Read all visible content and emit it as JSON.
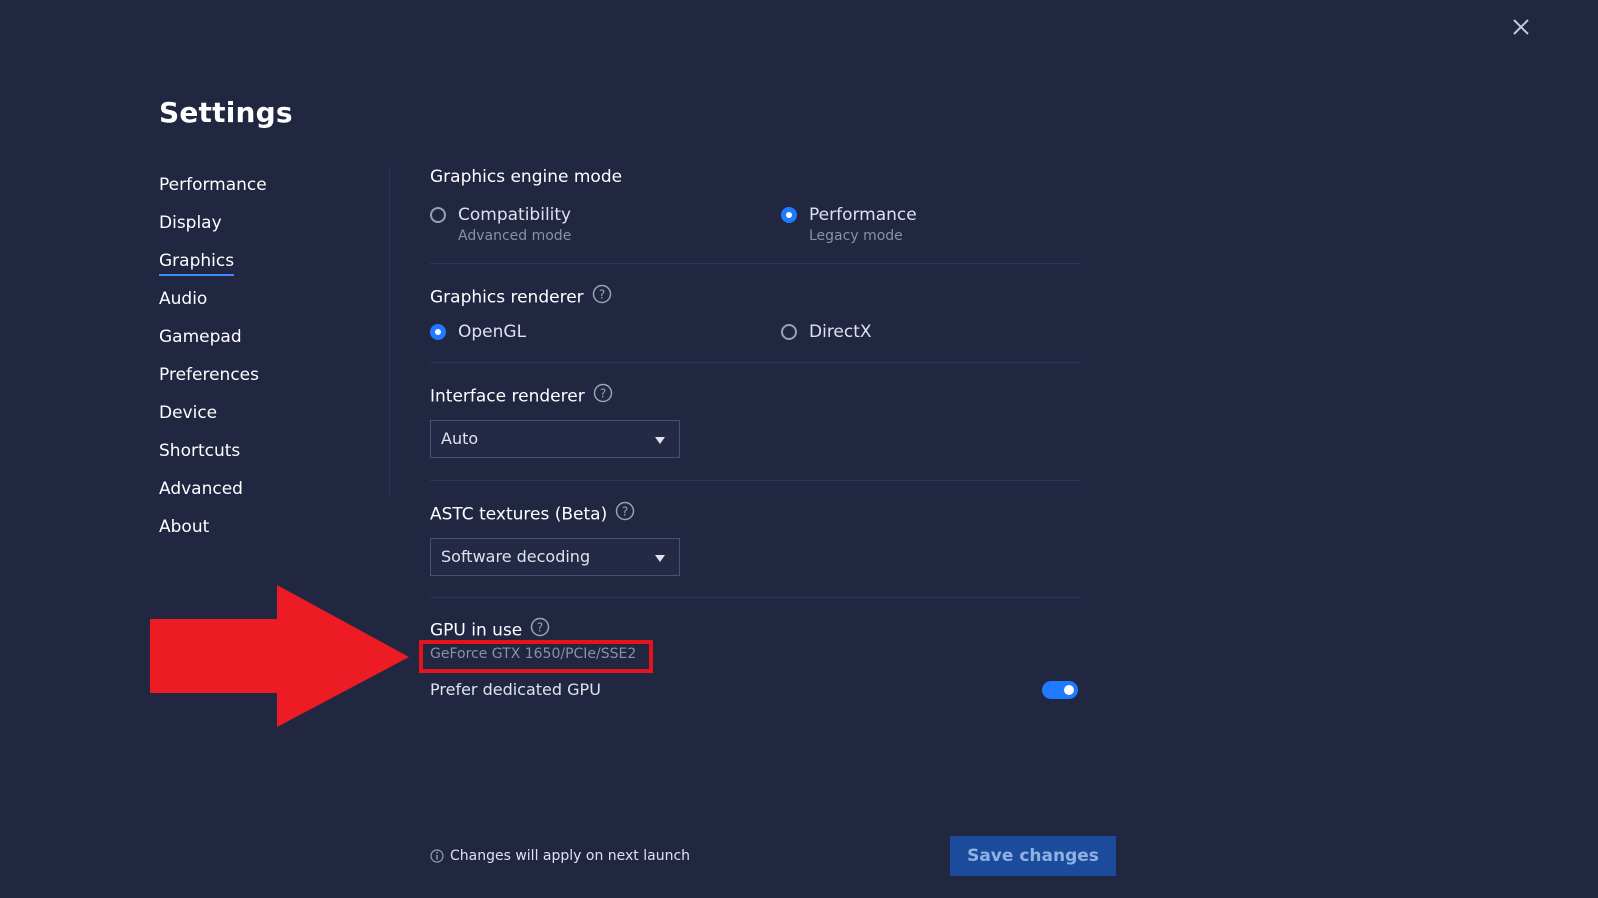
{
  "title": "Settings",
  "nav": {
    "items": [
      "Performance",
      "Display",
      "Graphics",
      "Audio",
      "Gamepad",
      "Preferences",
      "Device",
      "Shortcuts",
      "Advanced",
      "About"
    ],
    "active": "Graphics"
  },
  "engine": {
    "title": "Graphics engine mode",
    "options": [
      {
        "label": "Compatibility",
        "sub": "Advanced mode",
        "selected": false
      },
      {
        "label": "Performance",
        "sub": "Legacy mode",
        "selected": true
      }
    ]
  },
  "renderer": {
    "title": "Graphics renderer",
    "options": [
      {
        "label": "OpenGL",
        "selected": true
      },
      {
        "label": "DirectX",
        "selected": false
      }
    ]
  },
  "interface_renderer": {
    "title": "Interface renderer",
    "value": "Auto"
  },
  "astc": {
    "title": "ASTC textures (Beta)",
    "value": "Software decoding"
  },
  "gpu": {
    "title": "GPU in use",
    "name": "GeForce GTX 1650/PCIe/SSE2",
    "prefer_label": "Prefer dedicated GPU",
    "prefer_enabled": true
  },
  "footer": {
    "note": "Changes will apply on next launch",
    "save_label": "Save changes"
  },
  "colors": {
    "background": "#212641",
    "accent": "#1e7bff",
    "save_button": "#1b4b9b",
    "highlight": "#e5141c"
  },
  "icons": {
    "close": "close-icon",
    "help": "help-icon",
    "info": "info-icon",
    "caret": "chevron-down-icon",
    "annotation": "arrow-icon"
  }
}
